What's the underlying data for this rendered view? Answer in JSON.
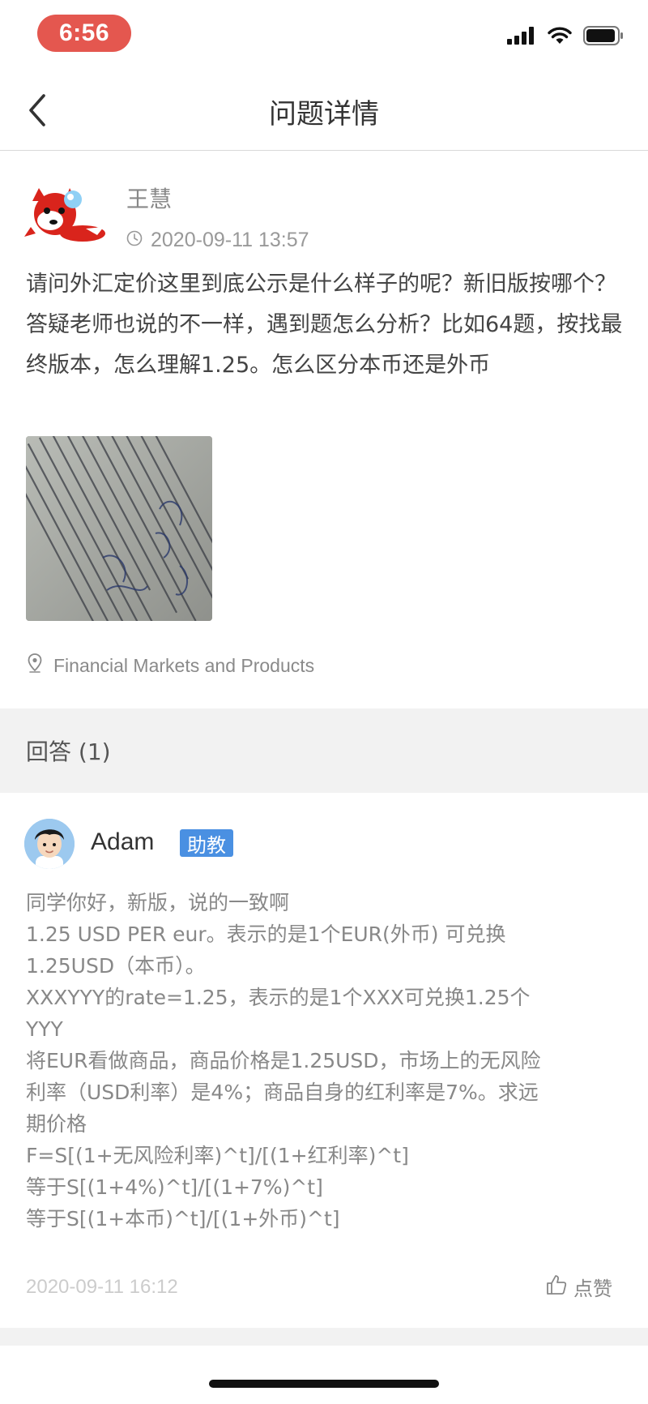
{
  "status_bar": {
    "time": "6:56",
    "icons": [
      "signal-icon",
      "wifi-icon",
      "battery-icon"
    ],
    "time_pill_color": "#e4574f"
  },
  "nav": {
    "back_icon": "chevron-left-icon",
    "title": "问题详情"
  },
  "question": {
    "username": "王慧",
    "timestamp": "2020-09-11 13:57",
    "body": "请问外汇定价这里到底公示是什么样子的呢？新旧版按哪个？答疑老师也说的不一样，遇到题怎么分析？比如64题，按找最终版本，怎么理解1.25。怎么区分本币还是外币",
    "tag": "Financial Markets and Products",
    "tag_icon": "location-pin-icon",
    "time_icon": "clock-icon"
  },
  "answers": {
    "title": "回答 (1)",
    "items": [
      {
        "username": "Adam",
        "badge": "助教",
        "badge_color": "#4a90e2",
        "lines": [
          "同学你好，新版，说的一致啊",
          "1.25 USD PER eur。表示的是1个EUR(外币) 可兑换",
          "1.25USD（本币）。",
          "XXXYYY的rate=1.25，表示的是1个XXX可兑换1.25个",
          "YYY",
          "将EUR看做商品，商品价格是1.25USD，市场上的无风险",
          "利率（USD利率）是4%；商品自身的红利率是7%。求远",
          "期价格",
          "F=S[(1+无风险利率)^t]/[(1+红利率)^t]",
          "等于S[(1+4%)^t]/[(1+7%)^t]",
          "等于S[(1+本币)^t]/[(1+外币)^t]"
        ],
        "timestamp": "2020-09-11 16:12",
        "like_label": "点赞",
        "like_icon": "thumbs-up-icon"
      }
    ]
  }
}
